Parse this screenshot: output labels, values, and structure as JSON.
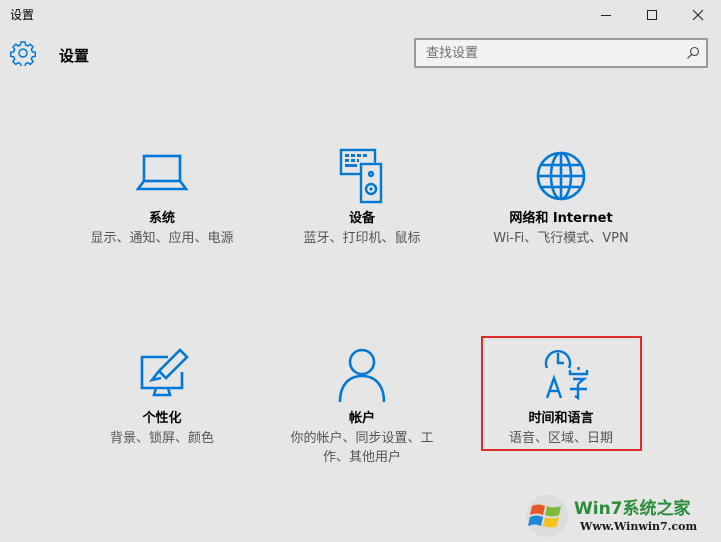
{
  "window": {
    "title": "设置"
  },
  "header": {
    "title": "设置",
    "search_placeholder": "查找设置"
  },
  "tiles": [
    {
      "title": "系统",
      "subtitle": "显示、通知、应用、电源",
      "icon": "laptop-icon"
    },
    {
      "title": "设备",
      "subtitle": "蓝牙、打印机、鼠标",
      "icon": "devices-icon"
    },
    {
      "title": "网络和 Internet",
      "subtitle": "Wi-Fi、飞行模式、VPN",
      "icon": "globe-icon"
    },
    {
      "title": "个性化",
      "subtitle": "背景、锁屏、颜色",
      "icon": "personalization-icon"
    },
    {
      "title": "帐户",
      "subtitle": "你的帐户、同步设置、工作、其他用户",
      "icon": "person-icon"
    },
    {
      "title": "时间和语言",
      "subtitle": "语音、区域、日期",
      "icon": "time-language-icon"
    }
  ],
  "watermark": {
    "name": "Win7系统之家",
    "url": "Www.Winwin7.com"
  },
  "colors": {
    "accent": "#0078d7",
    "background": "#e6e6e6",
    "highlight": "#e02b2b"
  }
}
